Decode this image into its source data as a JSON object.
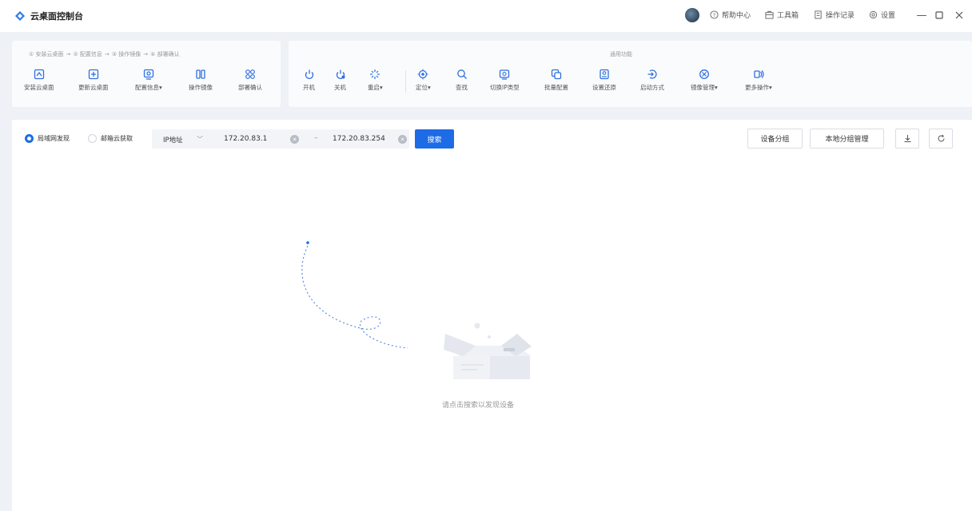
{
  "app": {
    "title": "云桌面控制台"
  },
  "titlebar": {
    "help": "帮助中心",
    "toolbox": "工具箱",
    "oplog": "操作记录",
    "settings": "设置"
  },
  "steps": [
    "① 安装云桌面",
    "② 配置信息",
    "③ 操作镜像",
    "④ 部署确认"
  ],
  "left_tools": [
    {
      "label": "安装云桌面",
      "icon": "install-icon"
    },
    {
      "label": "更新云桌面",
      "icon": "update-icon"
    },
    {
      "label": "配置信息▾",
      "icon": "config-icon"
    },
    {
      "label": "操作镜像",
      "icon": "mirror-icon"
    },
    {
      "label": "部署确认",
      "icon": "deploy-icon"
    }
  ],
  "common_title": "通用功能",
  "right_tools": [
    {
      "label": "开机",
      "icon": "power-on-icon"
    },
    {
      "label": "关机",
      "icon": "power-off-icon"
    },
    {
      "label": "重启▾",
      "icon": "restart-icon"
    },
    {
      "label": "定位▾",
      "icon": "locate-icon"
    },
    {
      "label": "查找",
      "icon": "search-icon"
    },
    {
      "label": "切换IP类型",
      "icon": "switch-ip-icon"
    },
    {
      "label": "批量配置",
      "icon": "batch-config-icon"
    },
    {
      "label": "设置还原",
      "icon": "restore-icon"
    },
    {
      "label": "启动方式",
      "icon": "boot-mode-icon"
    },
    {
      "label": "镜像管理▾",
      "icon": "image-manage-icon"
    },
    {
      "label": "更多操作▾",
      "icon": "more-icon"
    }
  ],
  "discovery": {
    "lan": "局域网发现",
    "cloud": "邮箱云获取",
    "ip_type": "IP地址",
    "ip_start": "172.20.83.1",
    "ip_end": "172.20.83.254",
    "search": "搜索"
  },
  "actions": {
    "group": "设备分组",
    "local_group": "本地分组管理"
  },
  "empty": {
    "text": "请点击搜索以发现设备"
  }
}
